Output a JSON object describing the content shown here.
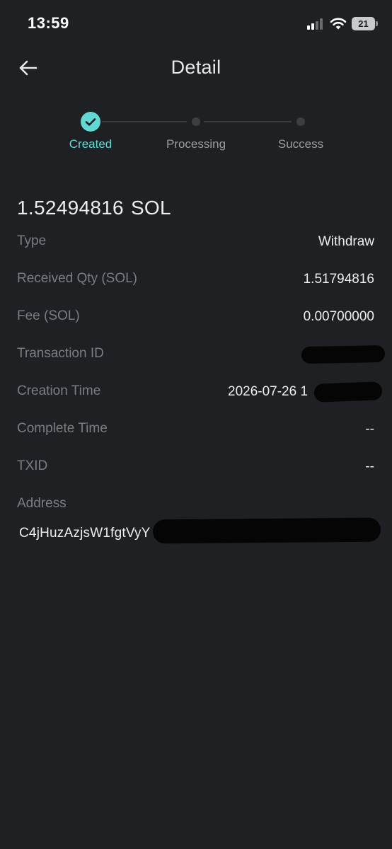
{
  "status_bar": {
    "time": "13:59",
    "battery": "21",
    "icons": [
      "cellular-signal-icon",
      "wifi-icon",
      "battery-icon"
    ]
  },
  "header": {
    "title": "Detail",
    "back_icon": "arrow-left-icon"
  },
  "stepper": {
    "steps": [
      {
        "label": "Created",
        "state": "done"
      },
      {
        "label": "Processing",
        "state": "pending"
      },
      {
        "label": "Success",
        "state": "pending"
      }
    ],
    "active_color": "#62d8d5",
    "inactive_color": "#9a9ca0"
  },
  "amount": {
    "value": "1.52494816",
    "unit": "SOL"
  },
  "details": {
    "type": {
      "label": "Type",
      "value": "Withdraw"
    },
    "received_qty": {
      "label": "Received Qty (SOL)",
      "value": "1.51794816"
    },
    "fee": {
      "label": "Fee (SOL)",
      "value": "0.00700000"
    },
    "transaction_id": {
      "label": "Transaction ID",
      "value": ""
    },
    "creation_time": {
      "label": "Creation Time",
      "value": "2026-07-26 1"
    },
    "complete_time": {
      "label": "Complete Time",
      "value": "--"
    },
    "txid": {
      "label": "TXID",
      "value": "--"
    },
    "address": {
      "label": "Address",
      "value": "C4jHuzAzjsW1fgtVyY"
    }
  },
  "colors": {
    "background": "#1f2023",
    "accent": "#62d8d5",
    "label": "#7a7d82",
    "value": "#eceef0"
  }
}
